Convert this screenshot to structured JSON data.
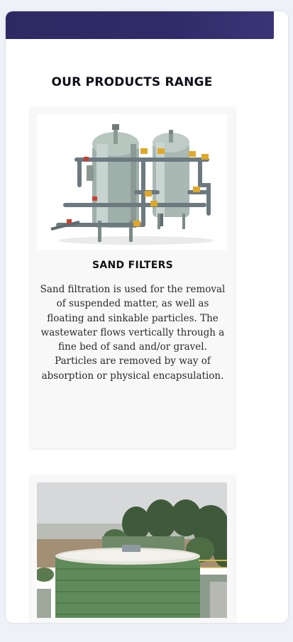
{
  "section": {
    "title": "OUR PRODUCTS RANGE"
  },
  "products": [
    {
      "name": "SAND FILTERS",
      "description": "Sand filtration is used for the removal of suspended matter, as well as floating and sinkable particles. The wastewater flows vertically through a fine bed of sand and/or gravel. Particles are removed by way of absorption or physical encapsulation.",
      "image": "sand-filter-vessels-image"
    },
    {
      "name": "",
      "description": "",
      "image": "outdoor-green-treatment-tank-image"
    }
  ],
  "colors": {
    "banner": "#2d2a63",
    "page_background": "#eef1f7",
    "card_background": "#f8f8f9"
  }
}
